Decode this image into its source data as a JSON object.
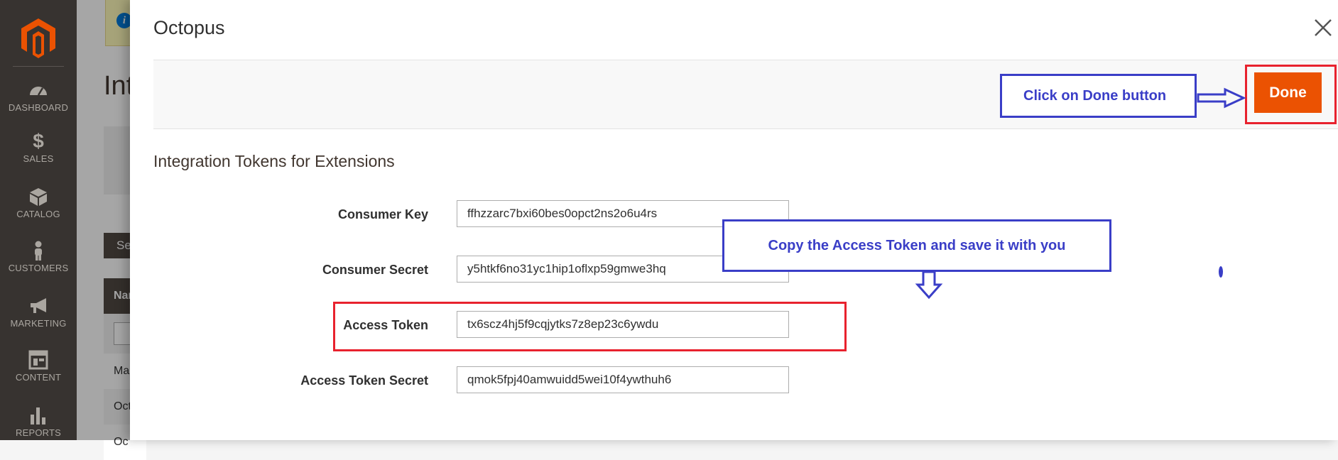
{
  "sidebar": {
    "logo": "magento-logo",
    "items": [
      {
        "label": "DASHBOARD",
        "icon": "speedometer-icon"
      },
      {
        "label": "SALES",
        "icon": "dollar-icon"
      },
      {
        "label": "CATALOG",
        "icon": "box-icon"
      },
      {
        "label": "CUSTOMERS",
        "icon": "person-icon"
      },
      {
        "label": "MARKETING",
        "icon": "megaphone-icon"
      },
      {
        "label": "CONTENT",
        "icon": "layout-icon"
      },
      {
        "label": "REPORTS",
        "icon": "bar-chart-icon"
      }
    ]
  },
  "background_page": {
    "info_icon_glyph": "i",
    "title_fragment": "Int",
    "button_fragment": "Se",
    "table_header_fragment": "Nar",
    "rows": [
      "Ma",
      "Oct",
      "Oc"
    ]
  },
  "modal": {
    "title": "Octopus",
    "close_icon": "close-icon",
    "done_label": "Done",
    "section_title": "Integration Tokens for Extensions",
    "fields": [
      {
        "label": "Consumer Key",
        "value": "ffhzzarc7bxi60bes0opct2ns2o6u4rs"
      },
      {
        "label": "Consumer Secret",
        "value": "y5htkf6no31yc1hip1oflxp59gmwe3hq"
      },
      {
        "label": "Access Token",
        "value": "tx6scz4hj5f9cqjytks7z8ep23c6ywdu"
      },
      {
        "label": "Access Token Secret",
        "value": "qmok5fpj40amwuidd5wei10f4ywthuh6"
      }
    ]
  },
  "annotations": {
    "done_note": "Click on Done button",
    "token_note": "Copy the Access Token and save it with you"
  },
  "colors": {
    "accent_orange": "#eb5202",
    "annotation_blue": "#3a3ec7",
    "annotation_red": "#e8222e",
    "sidebar_bg": "#373330"
  }
}
